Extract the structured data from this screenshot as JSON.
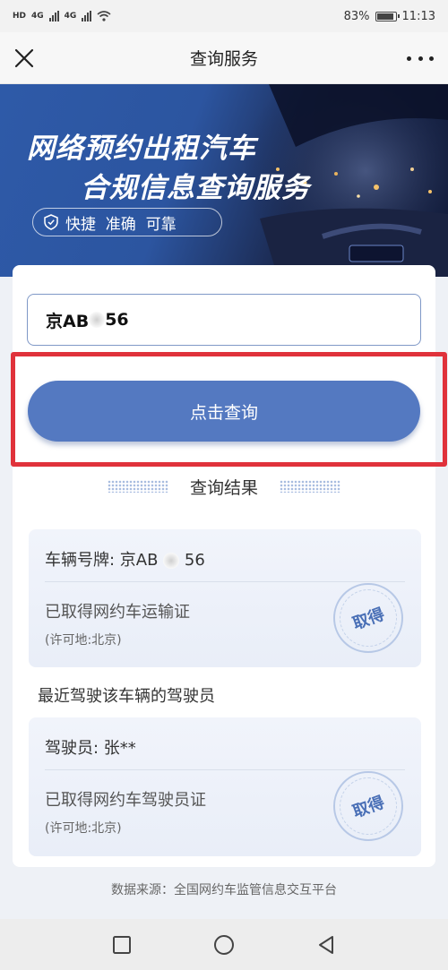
{
  "status_bar": {
    "network_left": "HD",
    "signal1_label": "4G",
    "signal2_label": "4G",
    "battery_text": "83%",
    "battery_level": 0.83,
    "time": "11:13"
  },
  "nav": {
    "title": "查询服务",
    "close_icon": "close-icon",
    "more_icon": "more-icon"
  },
  "banner": {
    "title_line1": "网络预约出租汽车",
    "title_line2": "合规信息查询服务",
    "badge_text": "快捷  准确  可靠"
  },
  "search": {
    "plate_prefix": "京AB",
    "plate_suffix": "56"
  },
  "query_button_label": "点击查询",
  "results": {
    "title": "查询结果",
    "vehicle": {
      "plate_label": "车辆号牌: 京AB",
      "plate_suffix": "56",
      "license_status": "已取得网约车运输证",
      "permit_place": "(许可地:北京)",
      "stamp_text": "取得"
    },
    "drivers_heading": "最近驾驶该车辆的驾驶员",
    "driver": {
      "name_line": "驾驶员: 张**",
      "license_status": "已取得网约车驾驶员证",
      "permit_place": "(许可地:北京)",
      "stamp_text": "取得"
    }
  },
  "footer": {
    "source_text": "数据来源：全国网约车监管信息交互平台"
  },
  "colors": {
    "accent": "#5479c1",
    "highlight": "#e0323b",
    "banner_blue": "#2c55a0"
  }
}
